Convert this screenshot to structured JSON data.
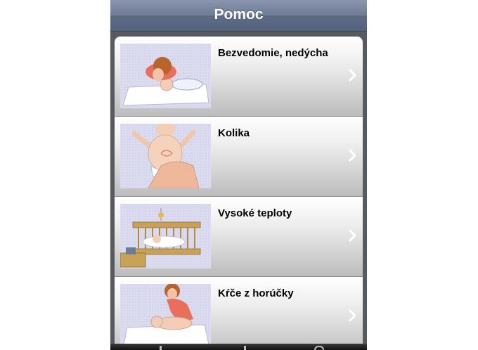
{
  "navbar": {
    "title": "Pomoc"
  },
  "items": [
    {
      "label": "Bezvedomie, nedýcha",
      "image": "infant-cpr-illustration",
      "icon": "chevron-right-icon"
    },
    {
      "label": "Kolika",
      "image": "baby-colic-massage-illustration",
      "icon": "chevron-right-icon"
    },
    {
      "label": "Vysoké teploty",
      "image": "baby-crib-fever-illustration",
      "icon": "chevron-right-icon"
    },
    {
      "label": "Kŕče z horúčky",
      "image": "febrile-seizure-illustration",
      "icon": "chevron-right-icon"
    }
  ],
  "colors": {
    "navbar": "#6d7b95",
    "row_top": "#ffffff",
    "row_bottom": "#bcbcbc",
    "chevron": "#ffffff"
  }
}
